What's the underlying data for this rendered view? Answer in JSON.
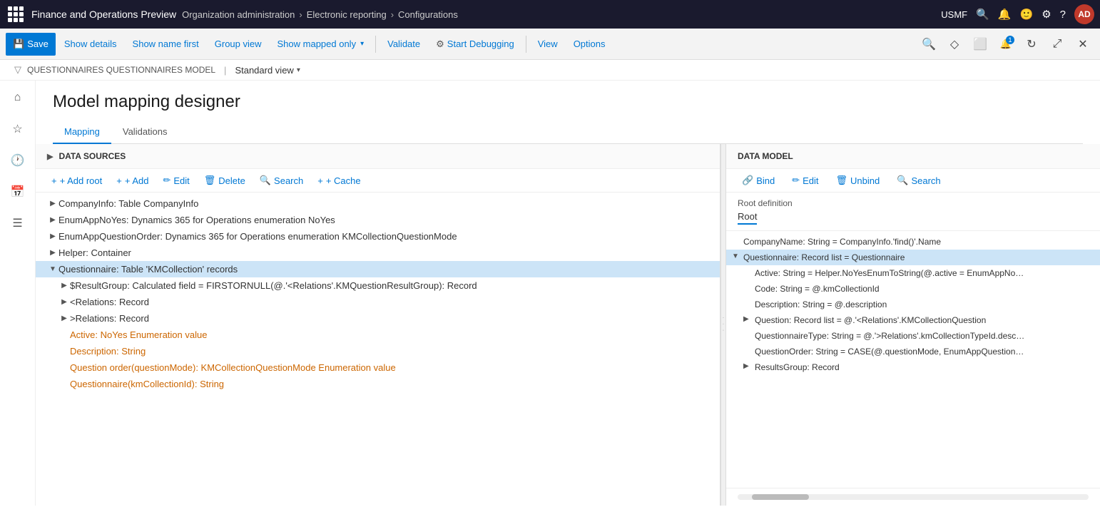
{
  "app": {
    "title": "Finance and Operations Preview",
    "company": "USMF"
  },
  "breadcrumb": {
    "items": [
      "Organization administration",
      "Electronic reporting",
      "Configurations"
    ]
  },
  "toolbar": {
    "save_label": "Save",
    "show_details_label": "Show details",
    "show_name_first_label": "Show name first",
    "group_view_label": "Group view",
    "show_mapped_only_label": "Show mapped only",
    "validate_label": "Validate",
    "start_debugging_label": "Start Debugging",
    "view_label": "View",
    "options_label": "Options"
  },
  "secondary_bar": {
    "breadcrumb_left": "QUESTIONNAIRES QUESTIONNAIRES MODEL",
    "divider": "|",
    "view_label": "Standard view"
  },
  "page": {
    "title": "Model mapping designer"
  },
  "tabs": [
    {
      "label": "Mapping",
      "active": true
    },
    {
      "label": "Validations",
      "active": false
    }
  ],
  "left_panel": {
    "header": "DATA SOURCES",
    "toolbar": {
      "add_root": "+ Add root",
      "add": "+ Add",
      "edit": "Edit",
      "delete": "Delete",
      "search": "Search",
      "cache": "+ Cache"
    },
    "tree": [
      {
        "indent": 0,
        "expand": "▶",
        "text": "CompanyInfo: Table CompanyInfo",
        "orange": false,
        "selected": false
      },
      {
        "indent": 0,
        "expand": "▶",
        "text": "EnumAppNoYes: Dynamics 365 for Operations enumeration NoYes",
        "orange": false,
        "selected": false
      },
      {
        "indent": 0,
        "expand": "▶",
        "text": "EnumAppQuestionOrder: Dynamics 365 for Operations enumeration KMCollectionQuestionMode",
        "orange": false,
        "selected": false
      },
      {
        "indent": 0,
        "expand": "▶",
        "text": "Helper: Container",
        "orange": false,
        "selected": false
      },
      {
        "indent": 0,
        "expand": "▼",
        "text": "Questionnaire: Table 'KMCollection' records",
        "orange": false,
        "selected": true
      },
      {
        "indent": 1,
        "expand": "▶",
        "text": "$ResultGroup: Calculated field = FIRSTORNULL(@.'<Relations'.KMQuestionResultGroup): Record",
        "orange": false,
        "selected": false
      },
      {
        "indent": 1,
        "expand": "▶",
        "text": "<Relations: Record",
        "orange": false,
        "selected": false
      },
      {
        "indent": 1,
        "expand": "▶",
        "text": ">Relations: Record",
        "orange": false,
        "selected": false
      },
      {
        "indent": 1,
        "expand": "",
        "text": "Active: NoYes Enumeration value",
        "orange": true,
        "selected": false
      },
      {
        "indent": 1,
        "expand": "",
        "text": "Description: String",
        "orange": true,
        "selected": false
      },
      {
        "indent": 1,
        "expand": "",
        "text": "Question order(questionMode): KMCollectionQuestionMode Enumeration value",
        "orange": true,
        "selected": false
      },
      {
        "indent": 1,
        "expand": "",
        "text": "Questionnaire(kmCollectionId): String",
        "orange": true,
        "selected": false
      }
    ]
  },
  "right_panel": {
    "header": "DATA MODEL",
    "toolbar": {
      "bind": "Bind",
      "edit": "Edit",
      "unbind": "Unbind",
      "search": "Search"
    },
    "root_definition_label": "Root definition",
    "root_value": "Root",
    "tree": [
      {
        "indent": 0,
        "expand": "",
        "text": "CompanyName: String = CompanyInfo.'find()'.Name",
        "selected": false
      },
      {
        "indent": 0,
        "expand": "▼",
        "text": "Questionnaire: Record list = Questionnaire",
        "selected": true
      },
      {
        "indent": 1,
        "expand": "",
        "text": "Active: String = Helper.NoYesEnumToString(@.active = EnumAppNo…",
        "selected": false
      },
      {
        "indent": 1,
        "expand": "",
        "text": "Code: String = @.kmCollectionId",
        "selected": false
      },
      {
        "indent": 1,
        "expand": "",
        "text": "Description: String = @.description",
        "selected": false
      },
      {
        "indent": 1,
        "expand": "▶",
        "text": "Question: Record list = @.'<Relations'.KMCollectionQuestion",
        "selected": false
      },
      {
        "indent": 1,
        "expand": "",
        "text": "QuestionnaireType: String = @.'>Relations'.kmCollectionTypeId.desc…",
        "selected": false
      },
      {
        "indent": 1,
        "expand": "",
        "text": "QuestionOrder: String = CASE(@.questionMode, EnumAppQuestion…",
        "selected": false
      },
      {
        "indent": 1,
        "expand": "▶",
        "text": "ResultsGroup: Record",
        "selected": false
      }
    ]
  }
}
